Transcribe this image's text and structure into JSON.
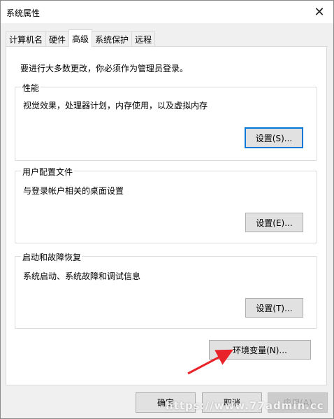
{
  "window": {
    "title": "系统属性",
    "close_glyph": "✕"
  },
  "tabs": [
    {
      "label": "计算机名",
      "active": false
    },
    {
      "label": "硬件",
      "active": false
    },
    {
      "label": "高级",
      "active": true
    },
    {
      "label": "系统保护",
      "active": false
    },
    {
      "label": "远程",
      "active": false
    }
  ],
  "intro_text": "要进行大多数更改，你必须作为管理员登录。",
  "performance": {
    "label": "性能",
    "desc": "视觉效果，处理器计划，内存使用，以及虚拟内存",
    "button": "设置(S)..."
  },
  "user_profiles": {
    "label": "用户配置文件",
    "desc": "与登录帐户相关的桌面设置",
    "button": "设置(E)..."
  },
  "startup_recovery": {
    "label": "启动和故障恢复",
    "desc": "系统启动、系统故障和调试信息",
    "button": "设置(T)..."
  },
  "env_button": "环境变量(N)...",
  "footer": {
    "ok": "确定",
    "cancel": "取消",
    "apply": "应用(A)"
  },
  "watermark": "https://www.77admin.cc",
  "colors": {
    "focus_border": "#0078d7",
    "arrow": "#e8232a"
  }
}
